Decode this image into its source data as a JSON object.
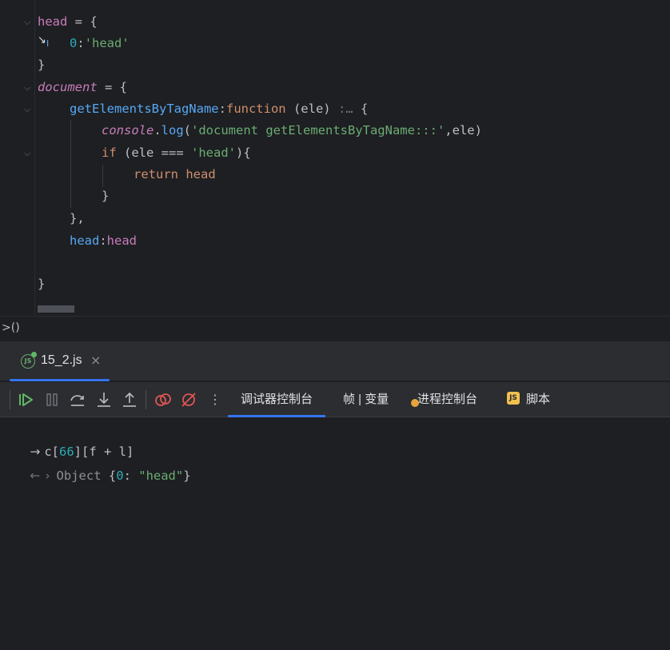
{
  "editor": {
    "lines": [
      {
        "t1": "head",
        "t2": " = {"
      },
      {
        "key": "0",
        "colon": ":",
        "val": "'head'"
      },
      {
        "t": "}"
      },
      {
        "t1": "document",
        "t2": " = {"
      },
      {
        "fn": "getElementsByTagName",
        "colon": ":",
        "kw": "function",
        "args": " (ele) ",
        "hint": ":… ",
        "brace": "{"
      },
      {
        "obj": "console",
        "dot": ".",
        "fn": "log",
        "open": "(",
        "str": "'document getElementsByTagName:::'",
        "rest": ",ele)"
      },
      {
        "kw": "if",
        "p1": " (ele === ",
        "str": "'head'",
        "p2": "){"
      },
      {
        "kw": "return",
        "id": " head"
      },
      {
        "t": "}"
      },
      {
        "t": "},"
      },
      {
        "key": "head",
        "colon": ":",
        "val": "head"
      },
      {
        "t": "}"
      }
    ],
    "fold_icon": "chevron-down-icon",
    "cursor_glyph": "↘",
    "text_cursor_glyph": "I"
  },
  "breadcrumb": {
    "text": ">()"
  },
  "debug_tab": {
    "label": "15_2.js",
    "close": "×",
    "icon": "JS"
  },
  "toolbar": {
    "buttons": [
      "resume-icon",
      "pause-icon",
      "step-over-icon",
      "step-into-icon",
      "step-out-icon",
      "view-breakpoints-icon",
      "mute-breakpoints-icon",
      "more-icon"
    ],
    "more": "⋮",
    "tabs": [
      {
        "label": "调试器控制台",
        "active": true
      },
      {
        "label": "帧 | 变量",
        "active": false
      },
      {
        "label": "进程控制台",
        "active": false
      },
      {
        "label": "脚本",
        "active": false
      }
    ],
    "js_badge": "JS"
  },
  "console": {
    "input": {
      "prompt": "→",
      "p1": "c[",
      "num": "66",
      "p2": "][f + l]"
    },
    "output": {
      "arrow": "←",
      "expand": "›",
      "type": "Object",
      "brace_open": "{",
      "key": "0",
      "sep": ": ",
      "val": "\"head\"",
      "brace_close": "}"
    }
  },
  "colors": {
    "background": "#1e1f22",
    "panel": "#2b2d30",
    "keyword": "#cf8e6d",
    "property": "#c77dbb",
    "function": "#56a8f5",
    "string": "#6aab73",
    "number": "#2aacb8",
    "accent": "#3574f0"
  }
}
